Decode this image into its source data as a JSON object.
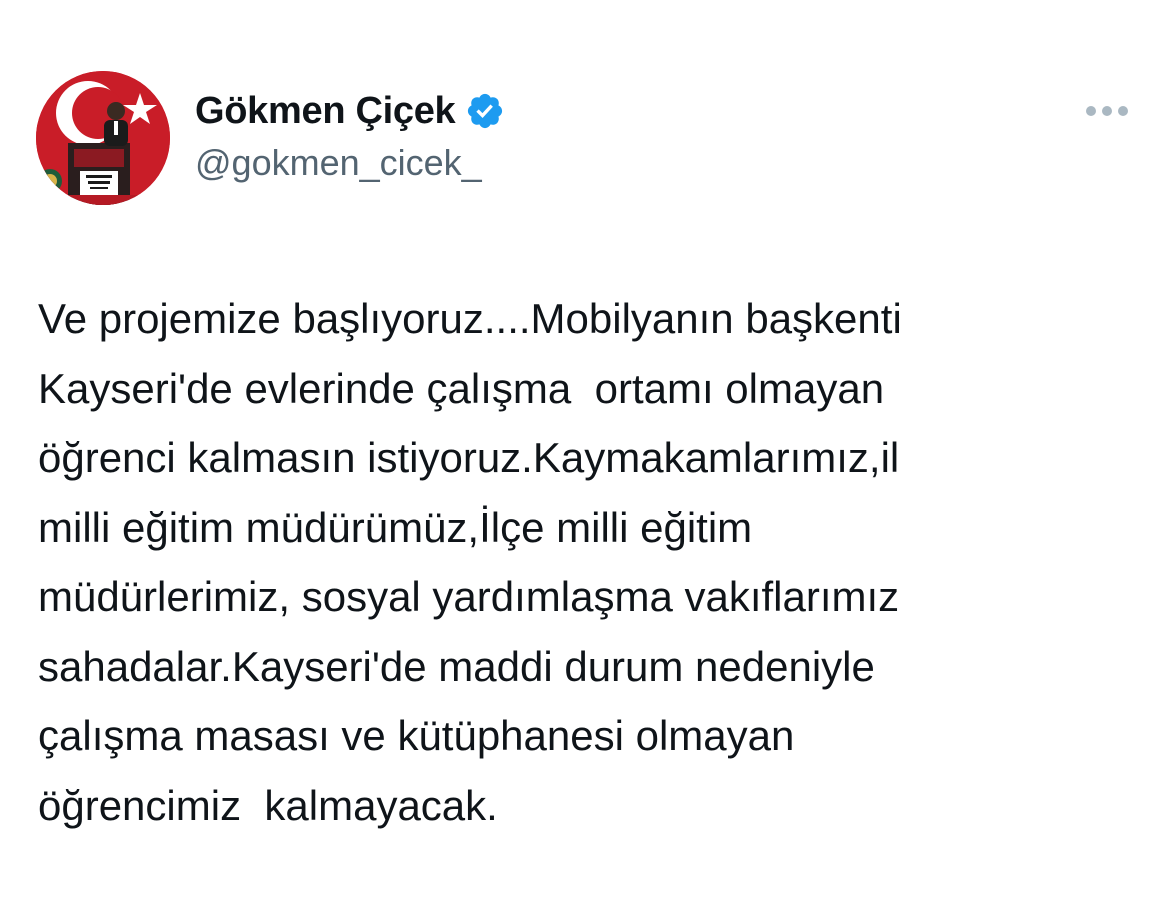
{
  "tweet": {
    "author": {
      "display_name": "Gökmen Çiçek",
      "handle": "@gokmen_cicek_",
      "verified": true,
      "verified_icon": "verified-badge-icon",
      "avatar_icon": "avatar-photo"
    },
    "more_icon": "more-options-icon",
    "text_lines": [
      "Ve projemize başlıyoruz....Mobilyanın başkenti",
      "Kayseri'de evlerinde çalışma  ortamı olmayan",
      "öğrenci kalmasın istiyoruz.Kaymakamlarımız,il",
      "milli eğitim müdürümüz,İlçe milli eğitim",
      "müdürlerimiz, sosyal yardımlaşma vakıflarımız",
      "sahadalar.Kayseri'de maddi durum nedeniyle",
      "çalışma masası ve kütüphanesi olmayan",
      "öğrencimiz  kalmayacak."
    ]
  },
  "colors": {
    "text_primary": "#0f1419",
    "text_secondary": "#536471",
    "verified_blue": "#1d9bf0",
    "avatar_red": "#d11f2b",
    "more_icon_gray": "#aab8c2"
  }
}
